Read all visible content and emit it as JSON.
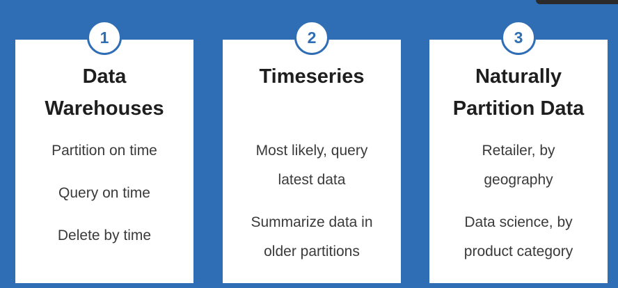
{
  "cards": [
    {
      "number": "1",
      "title_lines": [
        "Data",
        "Warehouses"
      ],
      "items": [
        [
          "Partition on time"
        ],
        [
          "Query on time"
        ],
        [
          "Delete by time"
        ]
      ]
    },
    {
      "number": "2",
      "title_lines": [
        "Timeseries"
      ],
      "items": [
        [
          "Most likely, query",
          "latest data"
        ],
        [
          "Summarize data in",
          "older partitions"
        ]
      ]
    },
    {
      "number": "3",
      "title_lines": [
        "Naturally",
        "Partition Data"
      ],
      "items": [
        [
          "Retailer, by",
          "geography"
        ],
        [
          "Data science, by",
          "product category"
        ]
      ]
    }
  ],
  "colors": {
    "background": "#2f6db5",
    "card": "#ffffff",
    "accent": "#2f6db5"
  }
}
